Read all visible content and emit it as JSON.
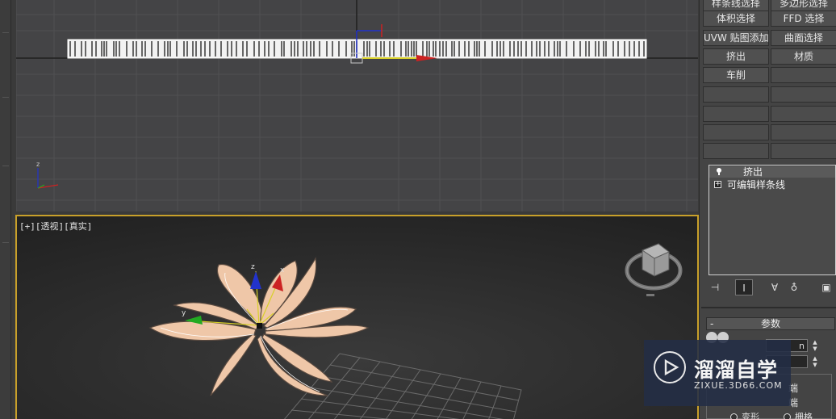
{
  "viewports": {
    "top": {
      "name": "top-viewport"
    },
    "perspective": {
      "label_plus": "[+]",
      "label_view": "[透视]",
      "label_shading": "[真实]",
      "gizmo_x": "x",
      "gizmo_y": "y",
      "gizmo_z": "z"
    }
  },
  "modifier_buttons": [
    {
      "label": "样条线选择"
    },
    {
      "label": "多边形选择"
    },
    {
      "label": "体积选择"
    },
    {
      "label": "FFD 选择"
    },
    {
      "label": "UVW 贴图添加"
    },
    {
      "label": "曲面选择"
    },
    {
      "label": "挤出"
    },
    {
      "label": "材质"
    },
    {
      "label": "车削"
    },
    {
      "label": ""
    }
  ],
  "modifier_stack": {
    "items": [
      {
        "label": "挤出",
        "icon": "lightbulb-icon"
      },
      {
        "label": "可编辑样条线",
        "icon": "expand-plus-icon"
      }
    ]
  },
  "stack_tools": [
    {
      "icon": "pin-stack-icon",
      "glyph": "⊣"
    },
    {
      "icon": "show-end-result-icon",
      "glyph": "Ⅰ"
    },
    {
      "icon": "make-unique-icon",
      "glyph": "∀"
    },
    {
      "icon": "remove-modifier-icon",
      "glyph": "♁"
    },
    {
      "icon": "configure-modifier-sets-icon",
      "glyph": "▣"
    }
  ],
  "parameters": {
    "title": "参数",
    "amount_suffix": "n",
    "cap_start_fragment": "端",
    "cap_end_fragment": "端",
    "morph_fragment": "变形",
    "grid_fragment": "栅格"
  },
  "watermark": {
    "title": "溜溜自学",
    "subtitle": "ZIXUE.3D66.COM"
  },
  "colors": {
    "viewport_border_active": "#c8a02a",
    "axis_x": "#cc2222",
    "axis_y": "#22aa22",
    "axis_z": "#2233cc",
    "flower_fill": "#efc7a8"
  }
}
